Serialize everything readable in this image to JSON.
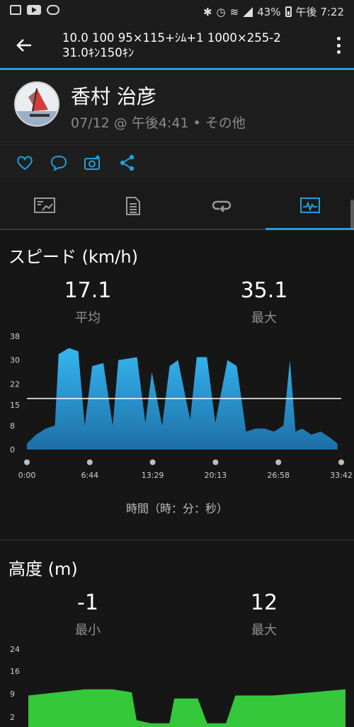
{
  "status_bar": {
    "battery": "43%",
    "time": "午後 7:22"
  },
  "app_bar": {
    "title_line1": "10.0 100 95×115+ｼﾑ+1 1000×255-2",
    "title_line2": "31.0ｷﾝ150ｷﾝ"
  },
  "profile": {
    "name": "香村 治彦",
    "date": "07/12 @ 午後4:41",
    "separator": "•",
    "category": "その他"
  },
  "actions": [
    "heart-icon",
    "comment-icon",
    "camera-add-icon",
    "share-icon"
  ],
  "tabs": [
    {
      "icon": "summary-chart-icon",
      "selected": false
    },
    {
      "icon": "details-list-icon",
      "selected": false
    },
    {
      "icon": "laps-loop-icon",
      "selected": false
    },
    {
      "icon": "graph-pulse-icon",
      "selected": true
    }
  ],
  "colors": {
    "accent": "#1ea0dc",
    "speed_fill": "#2fa0d8",
    "elevation_fill": "#35c83a"
  },
  "speed": {
    "title": "スピード (km/h)",
    "avg_value": "17.1",
    "avg_label": "平均",
    "max_value": "35.1",
    "max_label": "最大",
    "time_axis_label": "時間（時：分：秒）"
  },
  "elevation": {
    "title": "高度 (m)",
    "min_value": "-1",
    "min_label": "最小",
    "max_value": "12",
    "max_label": "最大"
  },
  "chart_data": [
    {
      "type": "area",
      "title": "スピード (km/h)",
      "xlabel": "時間（時：分：秒）",
      "x_ticks": [
        "0:00",
        "6:44",
        "13:29",
        "20:13",
        "26:58",
        "33:42"
      ],
      "y_ticks": [
        "38",
        "30",
        "22",
        "15",
        "8",
        "0"
      ],
      "ylim": [
        0,
        38
      ],
      "average_line": 17.1,
      "series": [
        {
          "x_minutes": [
            0,
            1,
            2,
            3,
            3.4,
            4.5,
            5.5,
            6.2,
            7,
            8.2,
            9.2,
            9.8,
            11.8,
            12.7,
            13.4,
            14.5,
            15.3,
            16.2,
            17.5,
            18.2,
            19.3,
            20.2,
            21.5,
            22.5,
            23.5,
            24.5,
            25.5,
            26.5,
            27.5,
            28.2,
            28.8,
            29.5,
            30.5,
            31.5,
            32.5,
            33.3
          ],
          "values": [
            2,
            5,
            7,
            8,
            32,
            34,
            33,
            8,
            28,
            29,
            8,
            30,
            31,
            9,
            26,
            8,
            28,
            30,
            10,
            31,
            31,
            9,
            30,
            28,
            6,
            7,
            7,
            6,
            8,
            30,
            6,
            7,
            5,
            6,
            4,
            2
          ]
        }
      ]
    },
    {
      "type": "area",
      "title": "高度 (m)",
      "y_ticks": [
        "24",
        "16",
        "9",
        "2"
      ],
      "ylim": [
        2,
        24
      ],
      "series": [
        {
          "x_minutes": [
            0,
            3,
            6,
            9,
            11,
            11.5,
            13,
            15,
            15.5,
            18,
            19,
            21,
            22,
            23.5,
            26,
            30,
            33.7
          ],
          "values": [
            9,
            10,
            11,
            11,
            10,
            1,
            0,
            0,
            8,
            8,
            0,
            0,
            9,
            9,
            9,
            10,
            11
          ]
        }
      ]
    }
  ]
}
